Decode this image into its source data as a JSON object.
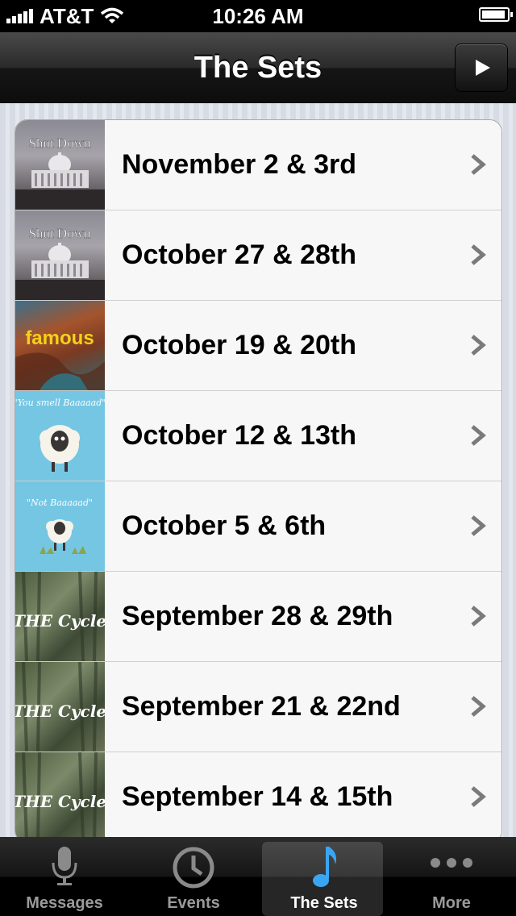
{
  "status_bar": {
    "carrier": "AT&T",
    "time": "10:26 AM"
  },
  "nav": {
    "title": "The Sets",
    "play_icon": "play-icon"
  },
  "sets": [
    {
      "label": "November 2 & 3rd",
      "art": "Shut Down"
    },
    {
      "label": "October 27 & 28th",
      "art": "Shut Down"
    },
    {
      "label": "October 19 & 20th",
      "art": "famous"
    },
    {
      "label": "October 12 & 13th",
      "art": "\"You smell Baaaaad\""
    },
    {
      "label": "October 5 & 6th",
      "art": "\"Not Baaaaad\""
    },
    {
      "label": "September 28 & 29th",
      "art": "THE Cycle"
    },
    {
      "label": "September 21 & 22nd",
      "art": "THE Cycle"
    },
    {
      "label": "September 14 & 15th",
      "art": "THE Cycle"
    }
  ],
  "tabs": [
    {
      "label": "Messages",
      "icon": "microphone-icon"
    },
    {
      "label": "Events",
      "icon": "clock-icon"
    },
    {
      "label": "The Sets",
      "icon": "music-note-icon",
      "active": true
    },
    {
      "label": "More",
      "icon": "more-dots-icon"
    }
  ],
  "colors": {
    "active_icon": "#3aa6f2",
    "sheep_bg": "#75c6e3",
    "famous_text": "#f2d21b"
  }
}
